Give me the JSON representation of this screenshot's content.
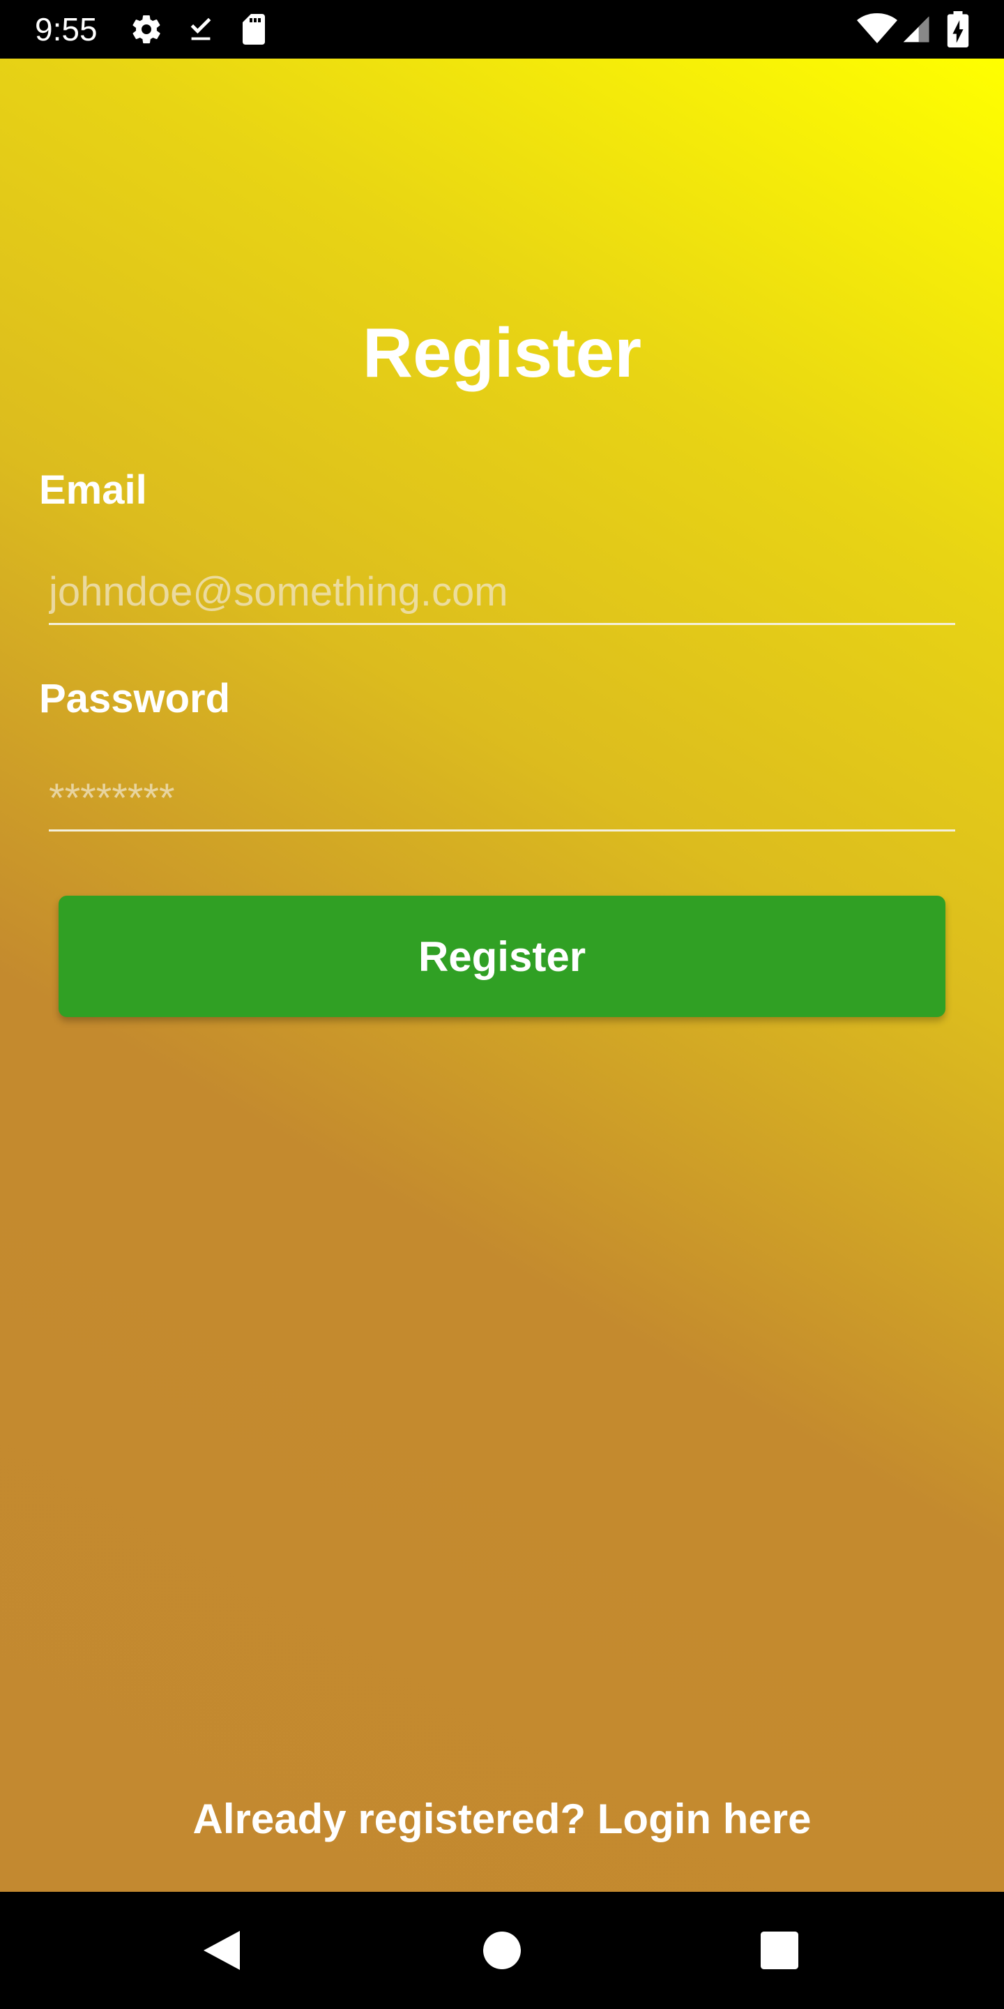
{
  "status_bar": {
    "time": "9:55",
    "left_icons": [
      "gear-icon",
      "download-done-icon",
      "sd-card-icon"
    ],
    "right_icons": [
      "wifi-icon",
      "cell-signal-icon",
      "battery-charging-icon"
    ]
  },
  "page": {
    "title": "Register",
    "background_colors": [
      "#ffff00",
      "#dcbc1e",
      "#c38930"
    ]
  },
  "form": {
    "email_label": "Email",
    "email_placeholder": "johndoe@something.com",
    "email_value": "",
    "password_label": "Password",
    "password_placeholder": "********",
    "password_value": "",
    "submit_label": "Register",
    "submit_color": "#30a024"
  },
  "footer": {
    "login_link": "Already registered? Login here"
  },
  "nav_bar": {
    "buttons": [
      "back-icon",
      "home-icon",
      "recents-icon"
    ]
  }
}
